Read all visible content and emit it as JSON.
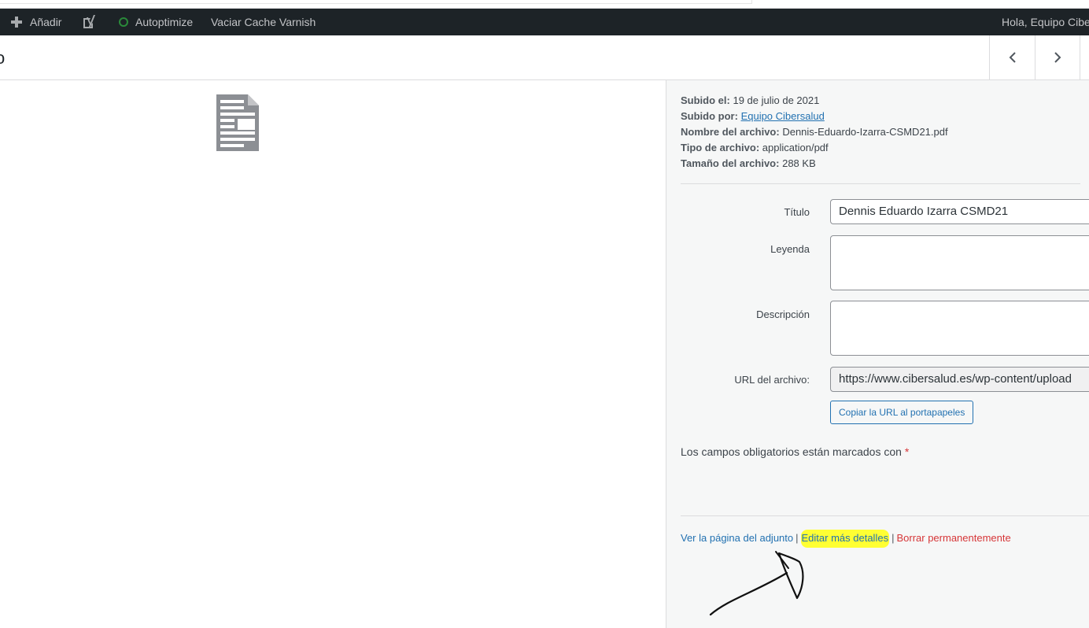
{
  "adminbar": {
    "add_label": "Añadir",
    "autoptimize_label": "Autoptimize",
    "varnish_label": "Vaciar Cache Varnish",
    "greeting": "Hola, Equipo Cibe"
  },
  "modal": {
    "title_fragment": "o"
  },
  "details": {
    "uploaded_on_label": "Subido el:",
    "uploaded_on_value": "19 de julio de 2021",
    "uploaded_by_label": "Subido por:",
    "uploaded_by_value": "Equipo Cibersalud",
    "filename_label": "Nombre del archivo:",
    "filename_value": "Dennis-Eduardo-Izarra-CSMD21.pdf",
    "filetype_label": "Tipo de archivo:",
    "filetype_value": "application/pdf",
    "filesize_label": "Tamaño del archivo:",
    "filesize_value": "288 KB"
  },
  "form": {
    "title_label": "Título",
    "title_value": "Dennis Eduardo Izarra CSMD21",
    "caption_label": "Leyenda",
    "caption_value": "",
    "description_label": "Descripción",
    "description_value": "",
    "url_label": "URL del archivo:",
    "url_value": "https://www.cibersalud.es/wp-content/upload",
    "copy_button_label": "Copiar la URL al portapapeles",
    "required_note": "Los campos obligatorios están marcados con",
    "required_asterisk": "*"
  },
  "actions": {
    "view_page": "Ver la página del adjunto",
    "edit_details": "Editar más detalles",
    "delete_permanently": "Borrar permanentemente",
    "separator": "|"
  },
  "colors": {
    "adminbar_bg": "#1d2327",
    "link": "#2271b1",
    "danger": "#d63638",
    "highlight": "#ffff33",
    "status_green": "#2a8a3a"
  }
}
